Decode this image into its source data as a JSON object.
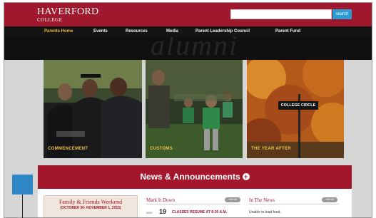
{
  "header": {
    "logo_line1": "HAVERFORD",
    "logo_line2": "COLLEGE",
    "search_placeholder": "",
    "search_button": "search"
  },
  "nav": {
    "items": [
      "Parents Home",
      "Events",
      "Resources",
      "Media",
      "Parent Leadership Council",
      "Parent Fund"
    ],
    "active_index": 0
  },
  "hero": {
    "watermark": "alumni"
  },
  "cards": [
    {
      "label": "COMMENCEMENT"
    },
    {
      "label": "CUSTOMS"
    },
    {
      "label": "THE YEAR AFTER",
      "sign_text": "COLLEGE CIRCLE"
    }
  ],
  "news": {
    "title": "News & Announcements",
    "plus": "+"
  },
  "promo": {
    "title": "Family & Friends Weekend",
    "dates": "(OCTOBER 30- NOVEMBER 1, 2015)"
  },
  "events": {
    "title": "Mark It Down",
    "pill": "view all",
    "month": "NOV",
    "day": "19",
    "item": "CLASSES RESUME AT 8:30 A.M."
  },
  "in_the_news": {
    "title": "In The News",
    "pill": "view all",
    "item": "Unable to load feed."
  },
  "colors": {
    "brand_red": "#a0182d",
    "nav_black": "#141414",
    "active_gold": "#e8b43c",
    "search_blue": "#2b9bd1",
    "callout_blue": "#2e86c6"
  }
}
